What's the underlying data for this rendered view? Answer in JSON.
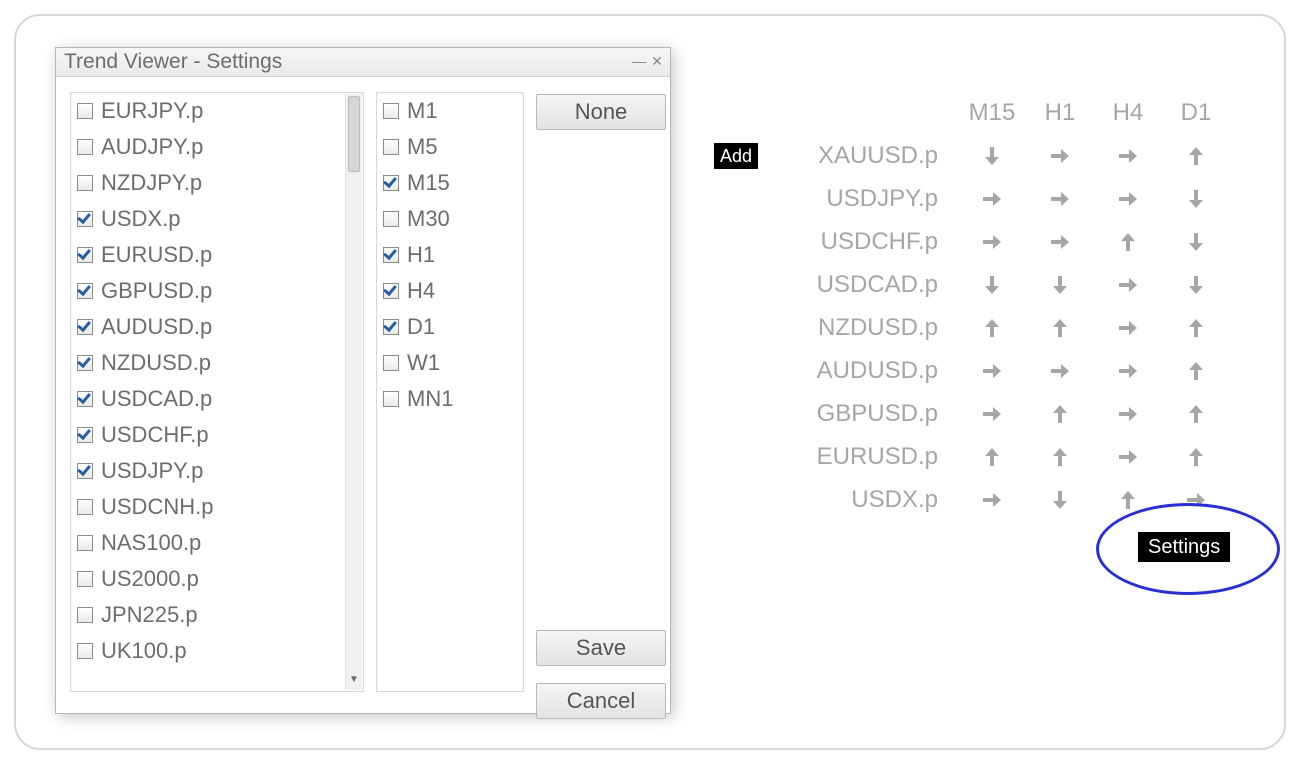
{
  "dialog": {
    "title": "Trend Viewer - Settings",
    "buttons": {
      "none": "None",
      "save": "Save",
      "cancel": "Cancel"
    },
    "symbols": [
      {
        "label": "EURJPY.p",
        "checked": false
      },
      {
        "label": "AUDJPY.p",
        "checked": false
      },
      {
        "label": "NZDJPY.p",
        "checked": false
      },
      {
        "label": "USDX.p",
        "checked": true
      },
      {
        "label": "EURUSD.p",
        "checked": true
      },
      {
        "label": "GBPUSD.p",
        "checked": true
      },
      {
        "label": "AUDUSD.p",
        "checked": true
      },
      {
        "label": "NZDUSD.p",
        "checked": true
      },
      {
        "label": "USDCAD.p",
        "checked": true
      },
      {
        "label": "USDCHF.p",
        "checked": true
      },
      {
        "label": "USDJPY.p",
        "checked": true
      },
      {
        "label": "USDCNH.p",
        "checked": false
      },
      {
        "label": "NAS100.p",
        "checked": false
      },
      {
        "label": "US2000.p",
        "checked": false
      },
      {
        "label": "JPN225.p",
        "checked": false
      },
      {
        "label": "UK100.p",
        "checked": false
      }
    ],
    "timeframes": [
      {
        "label": "M1",
        "checked": false
      },
      {
        "label": "M5",
        "checked": false
      },
      {
        "label": "M15",
        "checked": true
      },
      {
        "label": "M30",
        "checked": false
      },
      {
        "label": "H1",
        "checked": true
      },
      {
        "label": "H4",
        "checked": true
      },
      {
        "label": "D1",
        "checked": true
      },
      {
        "label": "W1",
        "checked": false
      },
      {
        "label": "MN1",
        "checked": false
      }
    ]
  },
  "viewer": {
    "add_label": "Add",
    "settings_label": "Settings",
    "columns": [
      "M15",
      "H1",
      "H4",
      "D1"
    ],
    "arrow_color": "#a7a6a6",
    "rows": [
      {
        "symbol": "XAUUSD.p",
        "arrows": [
          "down",
          "right",
          "right",
          "up"
        ]
      },
      {
        "symbol": "USDJPY.p",
        "arrows": [
          "right",
          "right",
          "right",
          "down"
        ]
      },
      {
        "symbol": "USDCHF.p",
        "arrows": [
          "right",
          "right",
          "up",
          "down"
        ]
      },
      {
        "symbol": "USDCAD.p",
        "arrows": [
          "down",
          "down",
          "right",
          "down"
        ]
      },
      {
        "symbol": "NZDUSD.p",
        "arrows": [
          "up",
          "up",
          "right",
          "up"
        ]
      },
      {
        "symbol": "AUDUSD.p",
        "arrows": [
          "right",
          "right",
          "right",
          "up"
        ]
      },
      {
        "symbol": "GBPUSD.p",
        "arrows": [
          "right",
          "up",
          "right",
          "up"
        ]
      },
      {
        "symbol": "EURUSD.p",
        "arrows": [
          "up",
          "up",
          "right",
          "up"
        ]
      },
      {
        "symbol": "USDX.p",
        "arrows": [
          "right",
          "down",
          "up",
          "right"
        ]
      }
    ]
  }
}
